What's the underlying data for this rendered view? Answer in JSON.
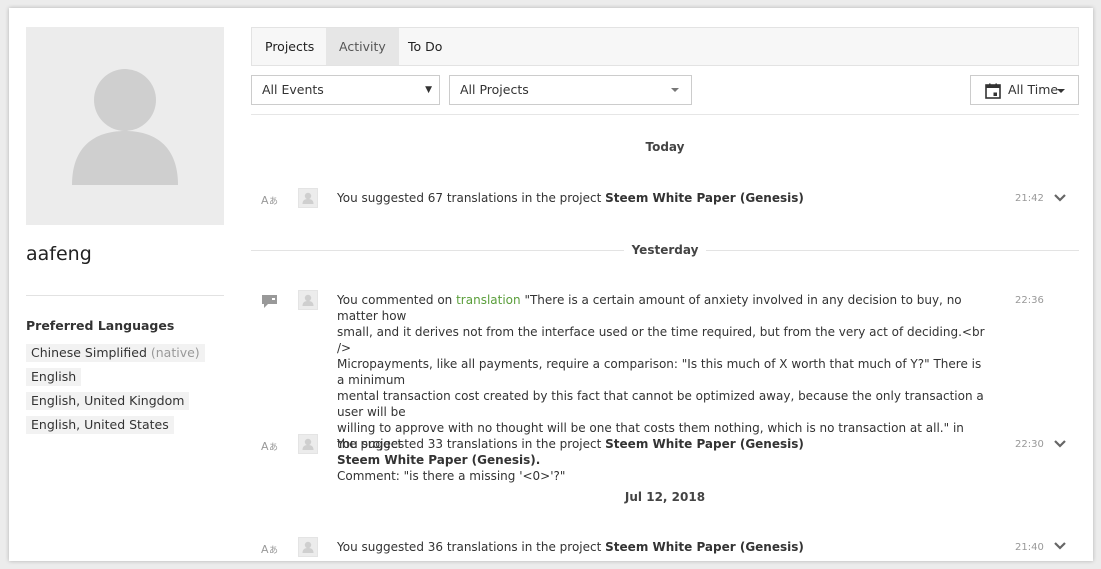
{
  "profile": {
    "username": "aafeng",
    "preferred_languages_title": "Preferred Languages",
    "languages": [
      {
        "name": "Chinese Simplified",
        "note": "(native)"
      },
      {
        "name": "English",
        "note": ""
      },
      {
        "name": "English, United Kingdom",
        "note": ""
      },
      {
        "name": "English, United States",
        "note": ""
      }
    ]
  },
  "tabs": [
    {
      "label": "Projects",
      "active": false
    },
    {
      "label": "Activity",
      "active": true
    },
    {
      "label": "To Do",
      "active": false
    }
  ],
  "filters": {
    "events": "All Events",
    "projects": "All Projects",
    "time": "All Time"
  },
  "days": [
    {
      "label": "Today"
    },
    {
      "label": "Yesterday"
    },
    {
      "label": "Jul 12, 2018"
    }
  ],
  "activity": [
    {
      "icon": "translate-icon",
      "prefix": "You suggested 67 translations in the project ",
      "project": "Steem White Paper (Genesis)",
      "time": "21:42"
    },
    {
      "icon": "comment-icon",
      "prefix": "You commented on ",
      "link": "translation",
      "quote_lines": [
        " \"There is a certain amount of anxiety involved in any decision to buy, no matter how",
        "small, and it derives not from the interface used or the time required, but from the very act of deciding.<br />",
        "Micropayments, like all payments, require a comparison: \"Is this much of X worth that much of Y?\" There is a minimum",
        "mental transaction cost created by this fact that cannot be optimized away, because the only transaction a user will be",
        "willing to approve with no thought will be one that costs them nothing, which is no transaction at all.\" in the project"
      ],
      "project": "Steem White Paper (Genesis).",
      "comment": "Comment: \"is there a missing '<0>'?\"",
      "time": "22:36"
    },
    {
      "icon": "translate-icon",
      "prefix": "You suggested 33 translations in the project ",
      "project": "Steem White Paper (Genesis)",
      "time": "22:30"
    },
    {
      "icon": "translate-icon",
      "prefix": "You suggested 36 translations in the project ",
      "project": "Steem White Paper (Genesis)",
      "time": "21:40"
    }
  ],
  "colors": {
    "link": "#5a9e3a",
    "tab_active_bg": "#e6e6e6",
    "avatar_bg": "#ececec"
  }
}
